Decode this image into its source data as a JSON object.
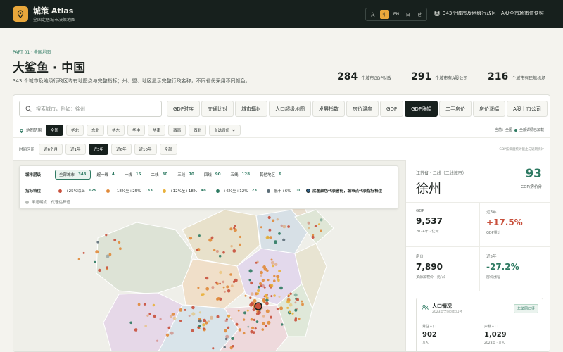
{
  "app": {
    "title": "城策 Atlas",
    "subtitle": "全国定居城市决策地图",
    "languages": [
      "文",
      "中",
      "EN",
      "日",
      "한"
    ],
    "active_language": "中",
    "db_info": "343个城市及地级行政区 · A股全市场市值快照"
  },
  "header": {
    "part": "PART 01 · 全国地图",
    "title": "大鲨鱼 · 中国",
    "description": "343 个城市及地级行政区均有地图点与完整指标；州、盟、地区显示完整行政名称，不同省份采用不同颜色。",
    "stats": [
      {
        "value": "284",
        "label": "个城市GDP财政"
      },
      {
        "value": "291",
        "label": "个城市有A股公司"
      },
      {
        "value": "216",
        "label": "个城市有民航机场"
      }
    ]
  },
  "search": {
    "placeholder": "搜索城市，例如：徐州"
  },
  "main_tabs": [
    "GDP时序",
    "交通比对",
    "城市辐射",
    "人口超级地图",
    "发展指数",
    "房价温度",
    "GDP",
    "GDP涨幅",
    "二手房价",
    "房价涨幅",
    "A股上市公司"
  ],
  "active_tab": "GDP涨幅",
  "region_filter": {
    "label": "地图范围",
    "options": [
      "全国",
      "华北",
      "东北",
      "华东",
      "华中",
      "华南",
      "西南",
      "西北",
      "自选省份"
    ],
    "active": "全国"
  },
  "time_filter": {
    "label": "时间区间",
    "options": [
      "近6个月",
      "近1年",
      "近3年",
      "近6年",
      "近10年",
      "全部"
    ],
    "active": "近3年"
  },
  "current_info": {
    "prefix": "当前：全国",
    "link": "全部详情已加载"
  },
  "time_note": "GDP按年度统计截止与近期统计",
  "legend": {
    "tier_label": "城市层级",
    "tiers": [
      {
        "name": "全部城市",
        "count": "343"
      },
      {
        "name": "超一线",
        "count": "4"
      },
      {
        "name": "一线",
        "count": "15"
      },
      {
        "name": "二线",
        "count": "30"
      },
      {
        "name": "三线",
        "count": "70"
      },
      {
        "name": "四线",
        "count": "90"
      },
      {
        "name": "五线",
        "count": "128"
      },
      {
        "name": "其他地区",
        "count": "6"
      }
    ],
    "color_label": "指标档位",
    "bins": [
      {
        "name": "+25%以上",
        "count": "129",
        "color": "#c8503c"
      },
      {
        "name": "+18%至+25%",
        "count": "133",
        "color": "#e08a3a"
      },
      {
        "name": "+12%至+18%",
        "count": "48",
        "color": "#e9b13b"
      },
      {
        "name": "+6%至+12%",
        "count": "23",
        "color": "#2e7a62"
      },
      {
        "name": "低于+6%",
        "count": "10",
        "color": "#5d6e78"
      }
    ],
    "note": "底图颜色代表省份，城市点代表指标档位",
    "semi_note": "半透明点：代理估算值"
  },
  "city": {
    "meta": "江苏省 · 二线（二线城市）",
    "name": "徐州",
    "score": "93",
    "score_label": "GDP/房价分",
    "metrics": [
      {
        "label": "GDP",
        "value": "9,537",
        "sub": "2024年 · 亿元",
        "tone": ""
      },
      {
        "label": "近3年",
        "value": "+17.5%",
        "sub": "GDP累计",
        "tone": "red"
      },
      {
        "label": "房价",
        "value": "7,890",
        "sub": "多源加权价 · 元/㎡",
        "tone": ""
      },
      {
        "label": "近5年",
        "value": "-27.2%",
        "sub": "房价涨幅",
        "tone": "green"
      }
    ],
    "population": {
      "title": "人口情况",
      "sub": "2023年全国可比口径",
      "badge": "年鉴同口径",
      "cells": [
        {
          "label": "常住人口",
          "value": "902",
          "sub": "万人"
        },
        {
          "label": "户籍人口",
          "value": "1,029",
          "sub": "2023年 · 万人"
        }
      ]
    }
  }
}
